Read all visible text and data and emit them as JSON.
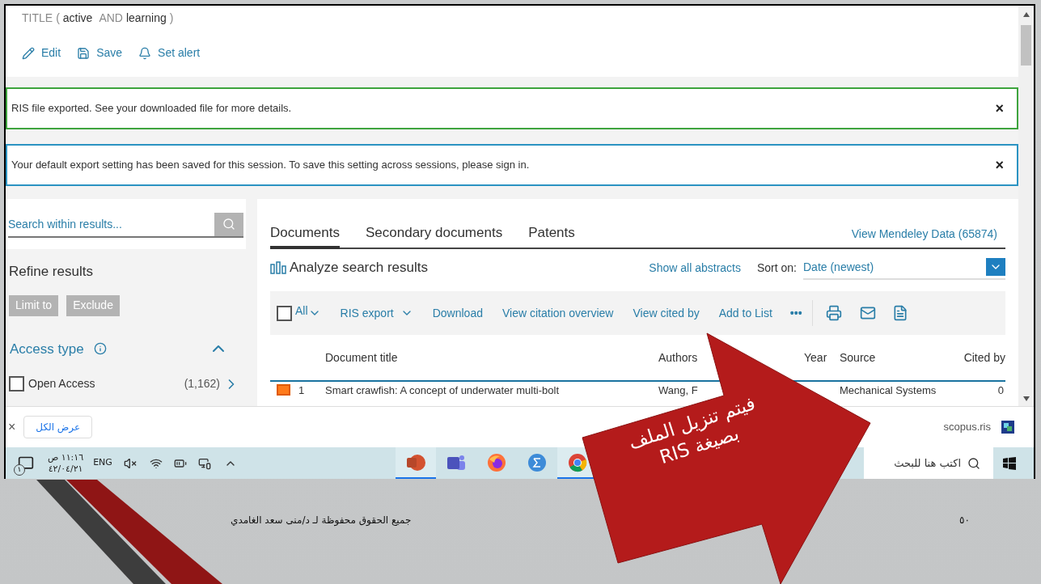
{
  "query": {
    "field": "TITLE",
    "open": "(",
    "term_1": "active",
    "operator": "AND",
    "term_2": "learning",
    "close": ")"
  },
  "actions": [
    {
      "kind": "edit",
      "label": "Edit"
    },
    {
      "kind": "save",
      "label": "Save"
    },
    {
      "kind": "alert",
      "label": "Set alert"
    }
  ],
  "alerts": [
    {
      "kind": "success",
      "text": "RIS file exported. See your downloaded file for more details.",
      "close": "×"
    },
    {
      "kind": "info",
      "text": "Your default export setting has been saved for this session. To save this setting across sessions, please sign in.",
      "close": "×"
    }
  ],
  "sidebar": {
    "search": {
      "placeholder": "Search within results..."
    },
    "title": "Refine results",
    "buttons": [
      "Limit to",
      "Exclude"
    ],
    "filter": {
      "title": "Access type",
      "expanded": true,
      "options": [
        {
          "label": "Open Access",
          "count": "(1,162)",
          "checked": false
        }
      ]
    }
  },
  "tabs": [
    {
      "label": "Documents",
      "selected": true
    },
    {
      "label": "Secondary documents",
      "selected": false
    },
    {
      "label": "Patents",
      "selected": false
    }
  ],
  "mendeley_link": "View Mendeley Data (65874)",
  "analyze": "Analyze search results",
  "show_abstracts": "Show all abstracts",
  "sort": {
    "label": "Sort on:",
    "value": "Date (newest)"
  },
  "toolbar": {
    "select_all": {
      "label": "All",
      "checked": false
    },
    "actions": [
      {
        "label": "RIS export",
        "dropdown": true
      },
      {
        "label": "Download",
        "dropdown": false
      },
      {
        "label": "View citation overview",
        "dropdown": false
      },
      {
        "label": "View cited by",
        "dropdown": false
      },
      {
        "label": "Add to List",
        "dropdown": false
      }
    ],
    "more": "•••"
  },
  "table": {
    "columns": [
      "Document title",
      "Authors",
      "Year",
      "Source",
      "Cited by"
    ],
    "rows": [
      {
        "checked": true,
        "number": "1",
        "title": "Smart crawfish: A concept of underwater multi-bolt",
        "authors": "Wang, F",
        "source": "Mechanical Systems",
        "cited_by": "0"
      }
    ]
  },
  "download_bar": {
    "close": "×",
    "show_all": "عرض الكل",
    "file": "scopus.ris"
  },
  "taskbar": {
    "notification_count": "١",
    "time": "١١:١٦ ص",
    "date": "٤٢/٠٤/٢١",
    "language": "ENG",
    "apps": [
      {
        "kind": "powerpoint",
        "active": true
      },
      {
        "kind": "teams",
        "active": false
      },
      {
        "kind": "firefox",
        "active": false
      },
      {
        "kind": "math",
        "active": false
      },
      {
        "kind": "chrome",
        "active": true
      }
    ],
    "search": {
      "placeholder": "اكتب هنا للبحث"
    }
  },
  "slide": {
    "footer": "جميع الحقوق محفوظة لـ د/منى سعد الغامدي",
    "page_number": "٥٠",
    "callout": [
      "فيتم تنزيل الملف",
      "بصيغة RIS"
    ]
  }
}
